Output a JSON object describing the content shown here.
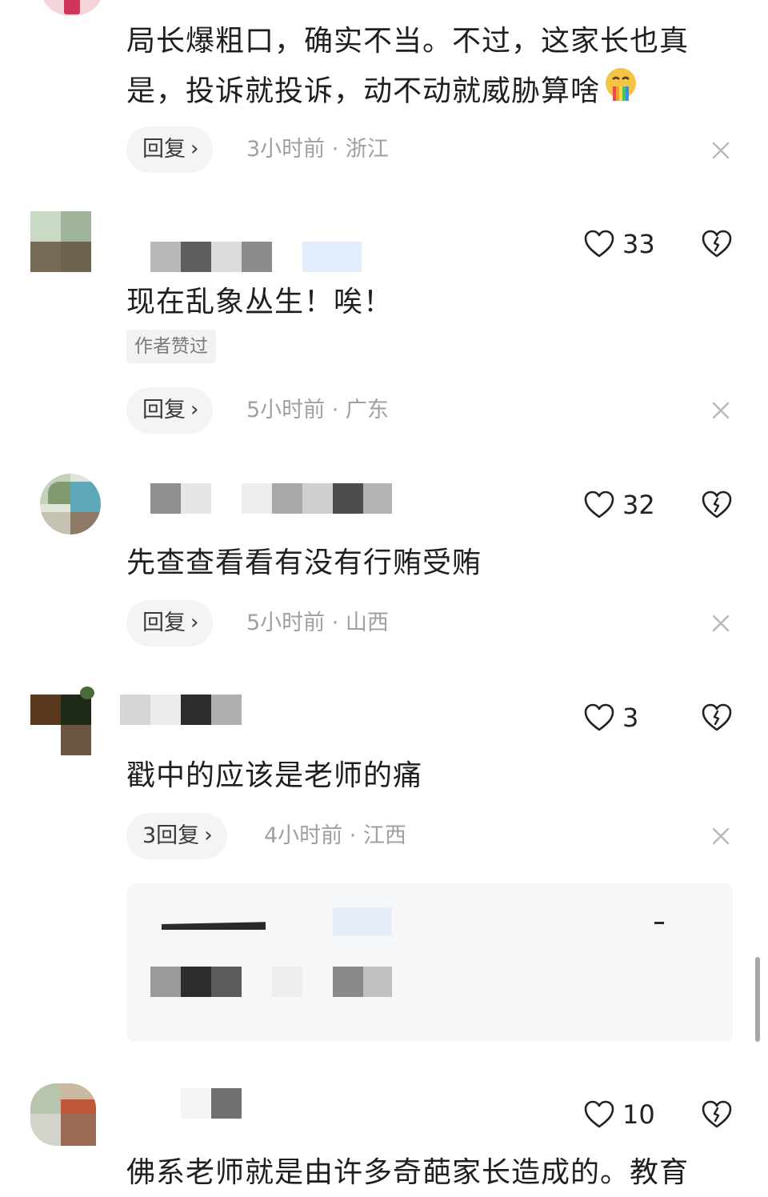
{
  "comments": [
    {
      "text_lines": [
        "局长爆粗口，确实不当。不过，这家长也真",
        "是，投诉就投诉，动不动就威胁算啥"
      ],
      "reply_label": "回复",
      "time": "3小时前",
      "location": "浙江",
      "meta": "3小时前 · 浙江"
    },
    {
      "text": "现在乱象丛生！唉！",
      "badge": "作者赞过",
      "likes": "33",
      "reply_label": "回复",
      "meta": "5小时前 · 广东"
    },
    {
      "text": "先查查看看有没有行贿受贿",
      "likes": "32",
      "reply_label": "回复",
      "meta": "5小时前 · 山西"
    },
    {
      "text": "戳中的应该是老师的痛",
      "likes": "3",
      "reply_label": "3回复",
      "meta": "4小时前 · 江西"
    },
    {
      "text": "佛系老师就是由许多奇葩家长造成的。教育",
      "likes": "10"
    }
  ],
  "colors": {
    "reply_chip_bg": "#f3f4f6",
    "meta_text": "#a0a0a0",
    "reply_box_bg": "#f6f7f8"
  },
  "icons": [
    "heart-icon",
    "broken-heart-icon",
    "close-icon",
    "chevron-right-icon",
    "emoji-icon"
  ]
}
